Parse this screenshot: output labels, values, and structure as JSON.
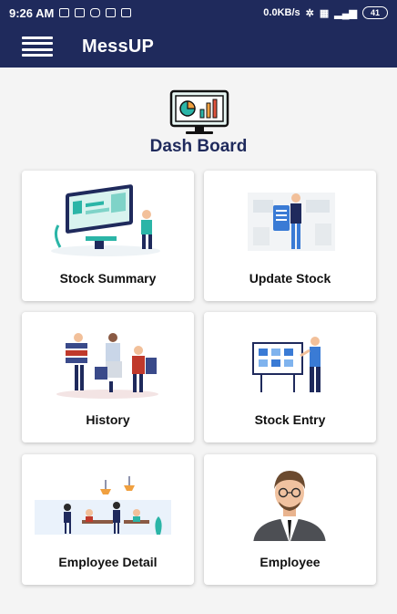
{
  "status_bar": {
    "time": "9:26 AM",
    "speed": "0.0KB/s",
    "battery": "41"
  },
  "app_bar": {
    "title": "MessUP",
    "menu_icon": "hamburger-menu-icon"
  },
  "dashboard": {
    "title": "Dash Board",
    "icon": "dashboard-monitor-icon"
  },
  "cards": [
    {
      "label": "Stock Summary",
      "icon": "stock-summary-illustration"
    },
    {
      "label": "Update Stock",
      "icon": "update-stock-illustration"
    },
    {
      "label": "History",
      "icon": "history-illustration"
    },
    {
      "label": "Stock Entry",
      "icon": "stock-entry-illustration"
    },
    {
      "label": "Employee Detail",
      "icon": "employee-detail-illustration"
    },
    {
      "label": "Employee",
      "icon": "employee-avatar-illustration"
    }
  ],
  "colors": {
    "primary": "#1f2a5c",
    "background": "#f4f4f4",
    "card": "#ffffff",
    "accent_teal": "#2bb5a7",
    "accent_orange": "#f0a040"
  }
}
